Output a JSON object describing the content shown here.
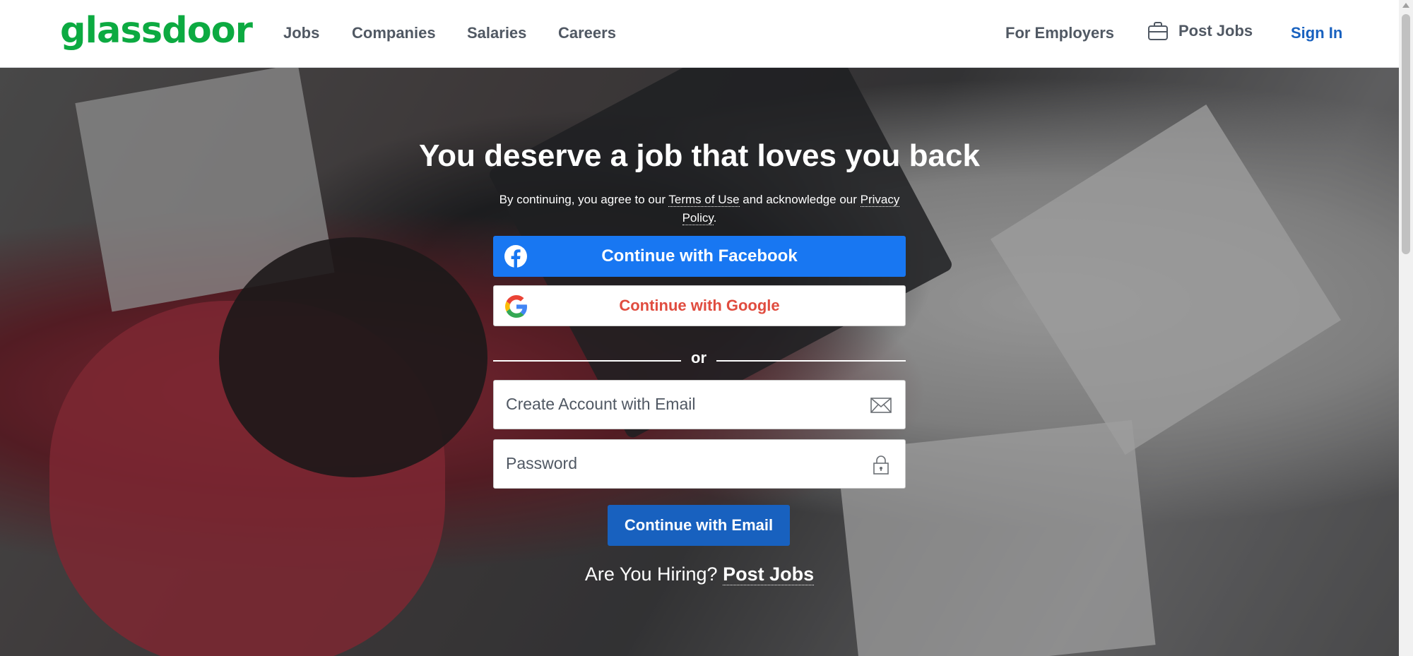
{
  "header": {
    "logo": "glassdoor",
    "nav": [
      "Jobs",
      "Companies",
      "Salaries",
      "Careers"
    ],
    "for_employers": "For Employers",
    "post_jobs": "Post Jobs",
    "sign_in": "Sign In"
  },
  "hero": {
    "title": "You deserve a job that loves you back",
    "terms_prefix": "By continuing, you agree to our ",
    "terms_link": "Terms of Use",
    "terms_middle": " and acknowledge our ",
    "privacy_link": "Privacy Policy",
    "terms_suffix": ".",
    "facebook_button": "Continue with Facebook",
    "google_button": "Continue with Google",
    "or": "or",
    "email_placeholder": "Create Account with Email",
    "password_placeholder": "Password",
    "email_button": "Continue with Email",
    "hiring_prompt": "Are You Hiring?",
    "hiring_link": "Post Jobs"
  },
  "colors": {
    "brand_green": "#0caa41",
    "facebook_blue": "#1877f2",
    "primary_blue": "#1861bf",
    "google_red": "#e04c3f"
  },
  "icons": [
    "briefcase-icon",
    "facebook-icon",
    "google-icon",
    "envelope-icon",
    "lock-icon"
  ]
}
